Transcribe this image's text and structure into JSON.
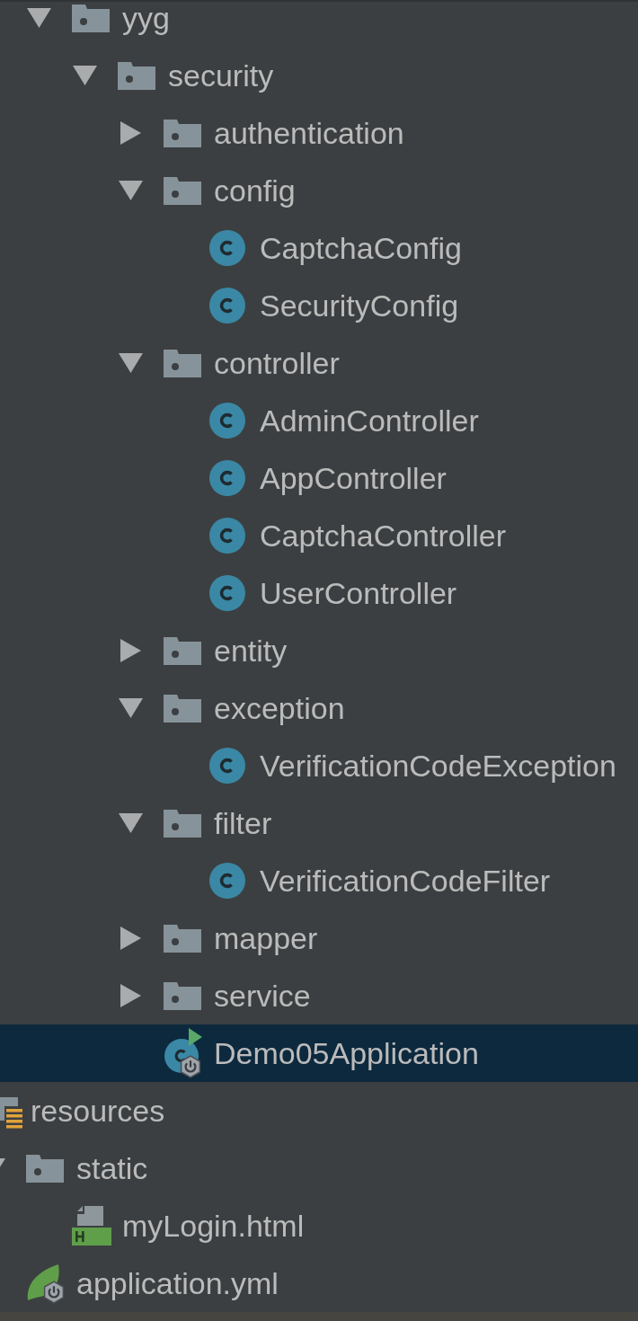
{
  "package_tree": [
    {
      "label": "yyg",
      "kind": "folder",
      "expanded": true,
      "selected": false,
      "children": [
        {
          "label": "security",
          "kind": "folder",
          "expanded": true,
          "selected": false,
          "children": [
            {
              "label": "authentication",
              "kind": "folder",
              "expanded": false,
              "selected": false
            },
            {
              "label": "config",
              "kind": "folder",
              "expanded": true,
              "selected": false,
              "children": [
                {
                  "label": "CaptchaConfig",
                  "kind": "class",
                  "selected": false
                },
                {
                  "label": "SecurityConfig",
                  "kind": "class",
                  "selected": false
                }
              ]
            },
            {
              "label": "controller",
              "kind": "folder",
              "expanded": true,
              "selected": false,
              "children": [
                {
                  "label": "AdminController",
                  "kind": "class",
                  "selected": false
                },
                {
                  "label": "AppController",
                  "kind": "class",
                  "selected": false
                },
                {
                  "label": "CaptchaController",
                  "kind": "class",
                  "selected": false
                },
                {
                  "label": "UserController",
                  "kind": "class",
                  "selected": false
                }
              ]
            },
            {
              "label": "entity",
              "kind": "folder",
              "expanded": false,
              "selected": false
            },
            {
              "label": "exception",
              "kind": "folder",
              "expanded": true,
              "selected": false,
              "children": [
                {
                  "label": "VerificationCodeException",
                  "kind": "class",
                  "selected": false
                }
              ]
            },
            {
              "label": "filter",
              "kind": "folder",
              "expanded": true,
              "selected": false,
              "children": [
                {
                  "label": "VerificationCodeFilter",
                  "kind": "class",
                  "selected": false
                }
              ]
            },
            {
              "label": "mapper",
              "kind": "folder",
              "expanded": false,
              "selected": false
            },
            {
              "label": "service",
              "kind": "folder",
              "expanded": false,
              "selected": false
            },
            {
              "label": "Demo05Application",
              "kind": "application_class",
              "selected": true
            }
          ]
        }
      ]
    }
  ],
  "resources_tree": [
    {
      "label": "resources",
      "kind": "resource_root",
      "selected": false,
      "children": [
        {
          "label": "static",
          "kind": "folder",
          "expanded": true,
          "selected": false,
          "children": [
            {
              "label": "myLogin.html",
              "kind": "html_file",
              "selected": false
            }
          ]
        },
        {
          "label": "application.yml",
          "kind": "config_file",
          "selected": false
        }
      ]
    }
  ]
}
